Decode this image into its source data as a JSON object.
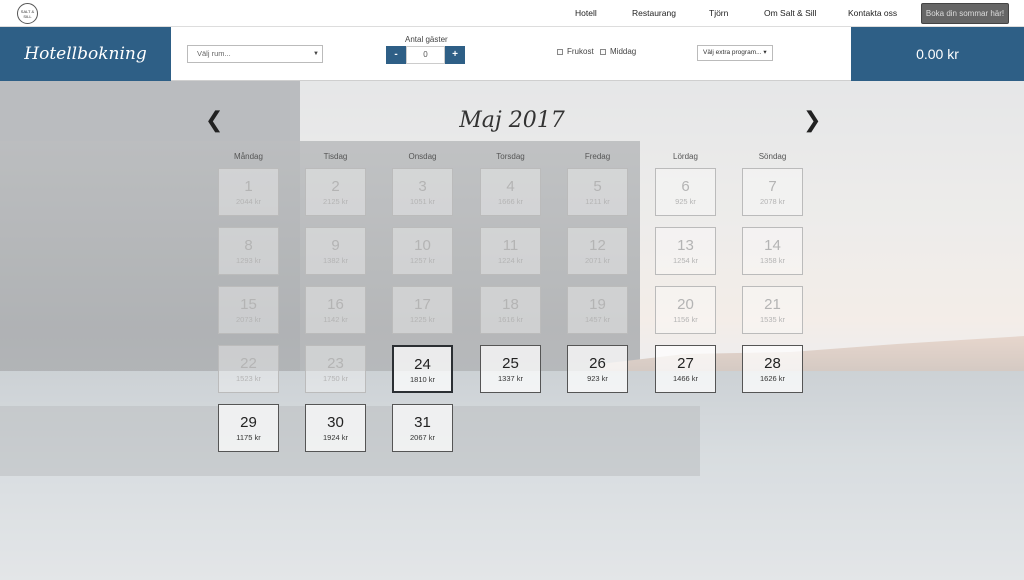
{
  "logo": {
    "text": "SALT & SILL"
  },
  "nav": {
    "items": [
      "Hotell",
      "Restaurang",
      "Tjörn",
      "Om Salt & Sill",
      "Kontakta oss"
    ],
    "book_button": "Boka din sommar här!"
  },
  "booking": {
    "title": "Hotellbokning",
    "room_placeholder": "Välj rum...",
    "guests_label": "Antal gäster",
    "guests_minus": "-",
    "guests_value": "0",
    "guests_plus": "+",
    "breakfast_label": "Frukost",
    "dinner_label": "Middag",
    "extra_program": "Välj extra program...",
    "total": "0.00 kr"
  },
  "calendar": {
    "month": "Maj 2017",
    "prev": "❮",
    "next": "❯",
    "weekdays": [
      "Måndag",
      "Tisdag",
      "Onsdag",
      "Torsdag",
      "Fredag",
      "Lördag",
      "Söndag"
    ],
    "days": [
      {
        "n": "1",
        "p": "2044 kr",
        "past": true
      },
      {
        "n": "2",
        "p": "2125 kr",
        "past": true
      },
      {
        "n": "3",
        "p": "1051 kr",
        "past": true
      },
      {
        "n": "4",
        "p": "1666 kr",
        "past": true
      },
      {
        "n": "5",
        "p": "1211 kr",
        "past": true
      },
      {
        "n": "6",
        "p": "925 kr",
        "past": true
      },
      {
        "n": "7",
        "p": "2078 kr",
        "past": true
      },
      {
        "n": "8",
        "p": "1293 kr",
        "past": true
      },
      {
        "n": "9",
        "p": "1382 kr",
        "past": true
      },
      {
        "n": "10",
        "p": "1257 kr",
        "past": true
      },
      {
        "n": "11",
        "p": "1224 kr",
        "past": true
      },
      {
        "n": "12",
        "p": "2071 kr",
        "past": true
      },
      {
        "n": "13",
        "p": "1254 kr",
        "past": true
      },
      {
        "n": "14",
        "p": "1358 kr",
        "past": true
      },
      {
        "n": "15",
        "p": "2073 kr",
        "past": true
      },
      {
        "n": "16",
        "p": "1142 kr",
        "past": true
      },
      {
        "n": "17",
        "p": "1225 kr",
        "past": true
      },
      {
        "n": "18",
        "p": "1616 kr",
        "past": true
      },
      {
        "n": "19",
        "p": "1457 kr",
        "past": true
      },
      {
        "n": "20",
        "p": "1156 kr",
        "past": true
      },
      {
        "n": "21",
        "p": "1535 kr",
        "past": true
      },
      {
        "n": "22",
        "p": "1523 kr",
        "past": true
      },
      {
        "n": "23",
        "p": "1750 kr",
        "past": true
      },
      {
        "n": "24",
        "p": "1810 kr",
        "past": false,
        "selected": true
      },
      {
        "n": "25",
        "p": "1337 kr",
        "past": false
      },
      {
        "n": "26",
        "p": "923 kr",
        "past": false
      },
      {
        "n": "27",
        "p": "1466 kr",
        "past": false
      },
      {
        "n": "28",
        "p": "1626 kr",
        "past": false
      },
      {
        "n": "29",
        "p": "1175 kr",
        "past": false
      },
      {
        "n": "30",
        "p": "1924 kr",
        "past": false
      },
      {
        "n": "31",
        "p": "2067 kr",
        "past": false
      }
    ]
  }
}
